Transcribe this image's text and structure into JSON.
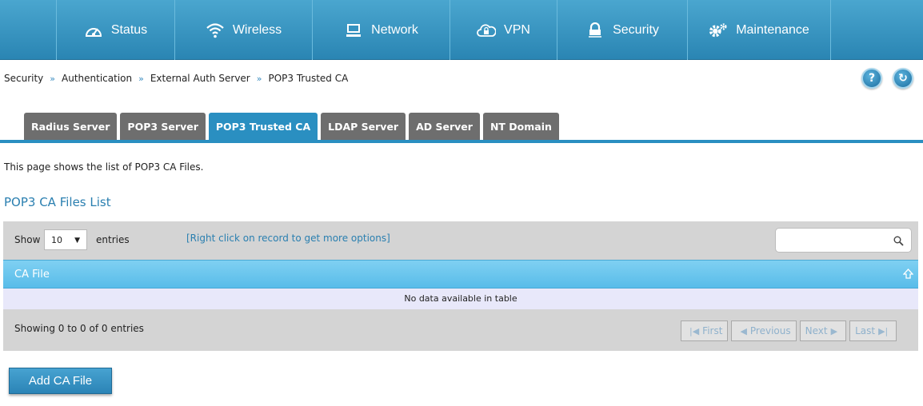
{
  "nav": {
    "items": [
      {
        "label": "Status",
        "icon": "gauge-icon"
      },
      {
        "label": "Wireless",
        "icon": "wifi-icon"
      },
      {
        "label": "Network",
        "icon": "monitor-icon"
      },
      {
        "label": "VPN",
        "icon": "cloud-lock-icon"
      },
      {
        "label": "Security",
        "icon": "lock-icon"
      },
      {
        "label": "Maintenance",
        "icon": "gears-icon"
      }
    ],
    "active": "Security"
  },
  "breadcrumb": {
    "items": [
      "Security",
      "Authentication",
      "External Auth Server",
      "POP3 Trusted CA"
    ],
    "separator": "»"
  },
  "header_buttons": {
    "help": "?",
    "refresh": "↻"
  },
  "tabs": {
    "items": [
      "Radius Server",
      "POP3 Server",
      "POP3 Trusted CA",
      "LDAP Server",
      "AD Server",
      "NT Domain"
    ],
    "active": "POP3 Trusted CA"
  },
  "page": {
    "description": "This page shows the list of POP3 CA Files.",
    "section_title": "POP3 CA Files List"
  },
  "table": {
    "show_label": "Show",
    "page_size": "10",
    "entries_label": "entries",
    "hint": "[Right click on record to get more options]",
    "search_value": "",
    "columns": [
      "CA File"
    ],
    "empty_message": "No data available in table",
    "info": "Showing 0 to 0 of 0 entries",
    "pager": {
      "first": "First",
      "previous": "Previous",
      "next": "Next",
      "last": "Last"
    }
  },
  "actions": {
    "add_label": "Add CA File"
  },
  "colors": {
    "accent": "#2a8fc1",
    "tab_inactive": "#6e6e6e",
    "header_row": "#58bce9"
  }
}
